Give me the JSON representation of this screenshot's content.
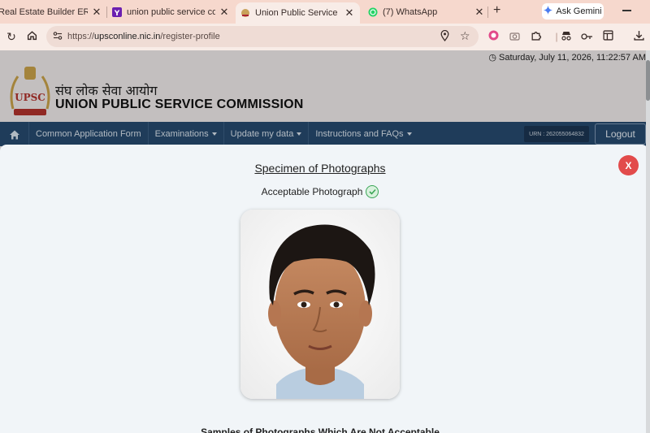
{
  "browser": {
    "tabs": [
      {
        "title": "Real Estate Builder ERP",
        "active": false
      },
      {
        "title": "union public service commission",
        "active": false
      },
      {
        "title": "Union Public Service Commission",
        "active": true
      },
      {
        "title": "(7) WhatsApp",
        "active": false
      }
    ],
    "new_tab_label": "+",
    "ask_gemini_label": "Ask Gemini",
    "url_prefix": "https://",
    "url_host": "upsconline.nic.in",
    "url_path": "/register-profile"
  },
  "site": {
    "datetime": "Saturday, July 11, 2026, 11:22:57 AM",
    "hindi_name": "संघ लोक सेवा आयोग",
    "english_name": "UNION PUBLIC SERVICE COMMISSION",
    "emblem_text": "UPSC"
  },
  "nav": {
    "items": [
      {
        "label": "Common Application Form",
        "dropdown": false
      },
      {
        "label": "Examinations",
        "dropdown": true
      },
      {
        "label": "Update my data",
        "dropdown": true
      },
      {
        "label": "Instructions and FAQs",
        "dropdown": true
      }
    ],
    "urn": "URN : 262055064832",
    "logout_label": "Logout"
  },
  "modal": {
    "title": "Specimen of Photographs",
    "acceptable_label": "Acceptable Photograph",
    "close_label": "X",
    "samples_label": "Samples of Photographs Which Are Not Acceptable"
  },
  "colors": {
    "navbar": "#264a6e",
    "close_button": "#e24b4b",
    "check_green": "#3aa656"
  }
}
